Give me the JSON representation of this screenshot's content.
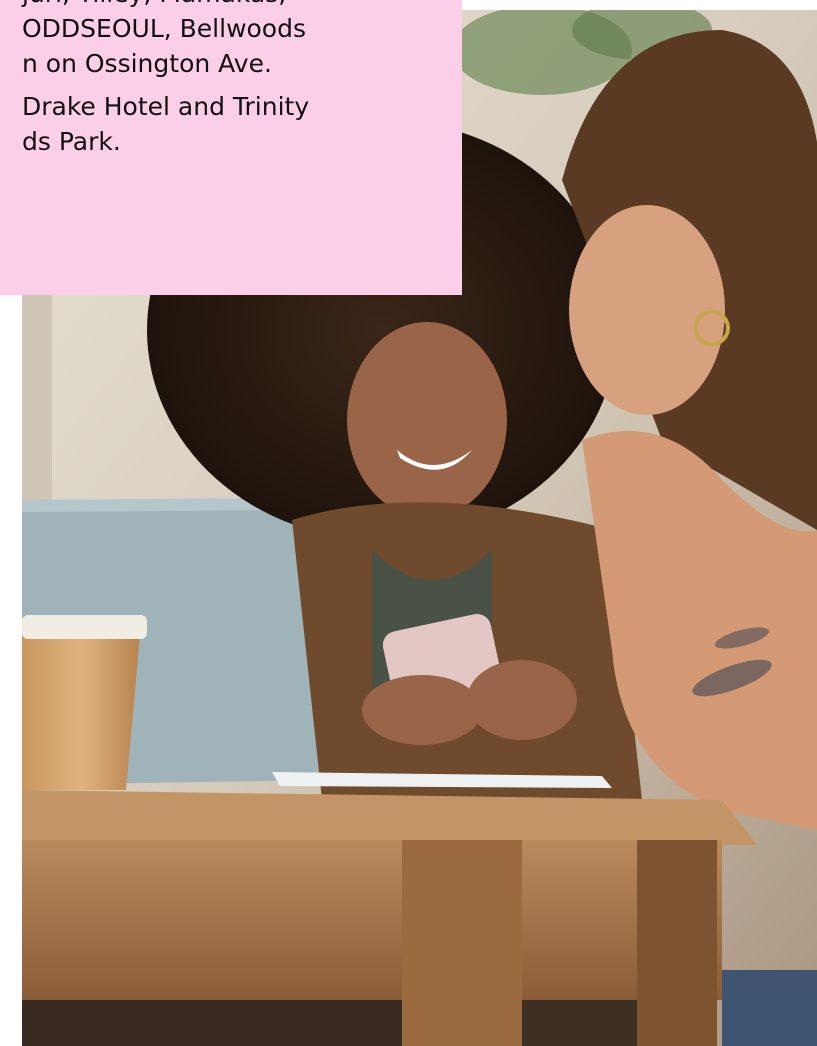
{
  "caption": {
    "paragraph_1": [
      "juri, Tilley, Mamakas,",
      "ODDSEOUL, Bellwoods",
      "n on Ossington Ave."
    ],
    "paragraph_2": [
      "Drake Hotel and Trinity",
      "ds Park."
    ]
  },
  "colors": {
    "caption_background": "#fbcfe7",
    "caption_text": "#111111"
  },
  "photo": {
    "subject": "two women laughing at a café table looking at a phone, with a laptop and coffee cup"
  }
}
